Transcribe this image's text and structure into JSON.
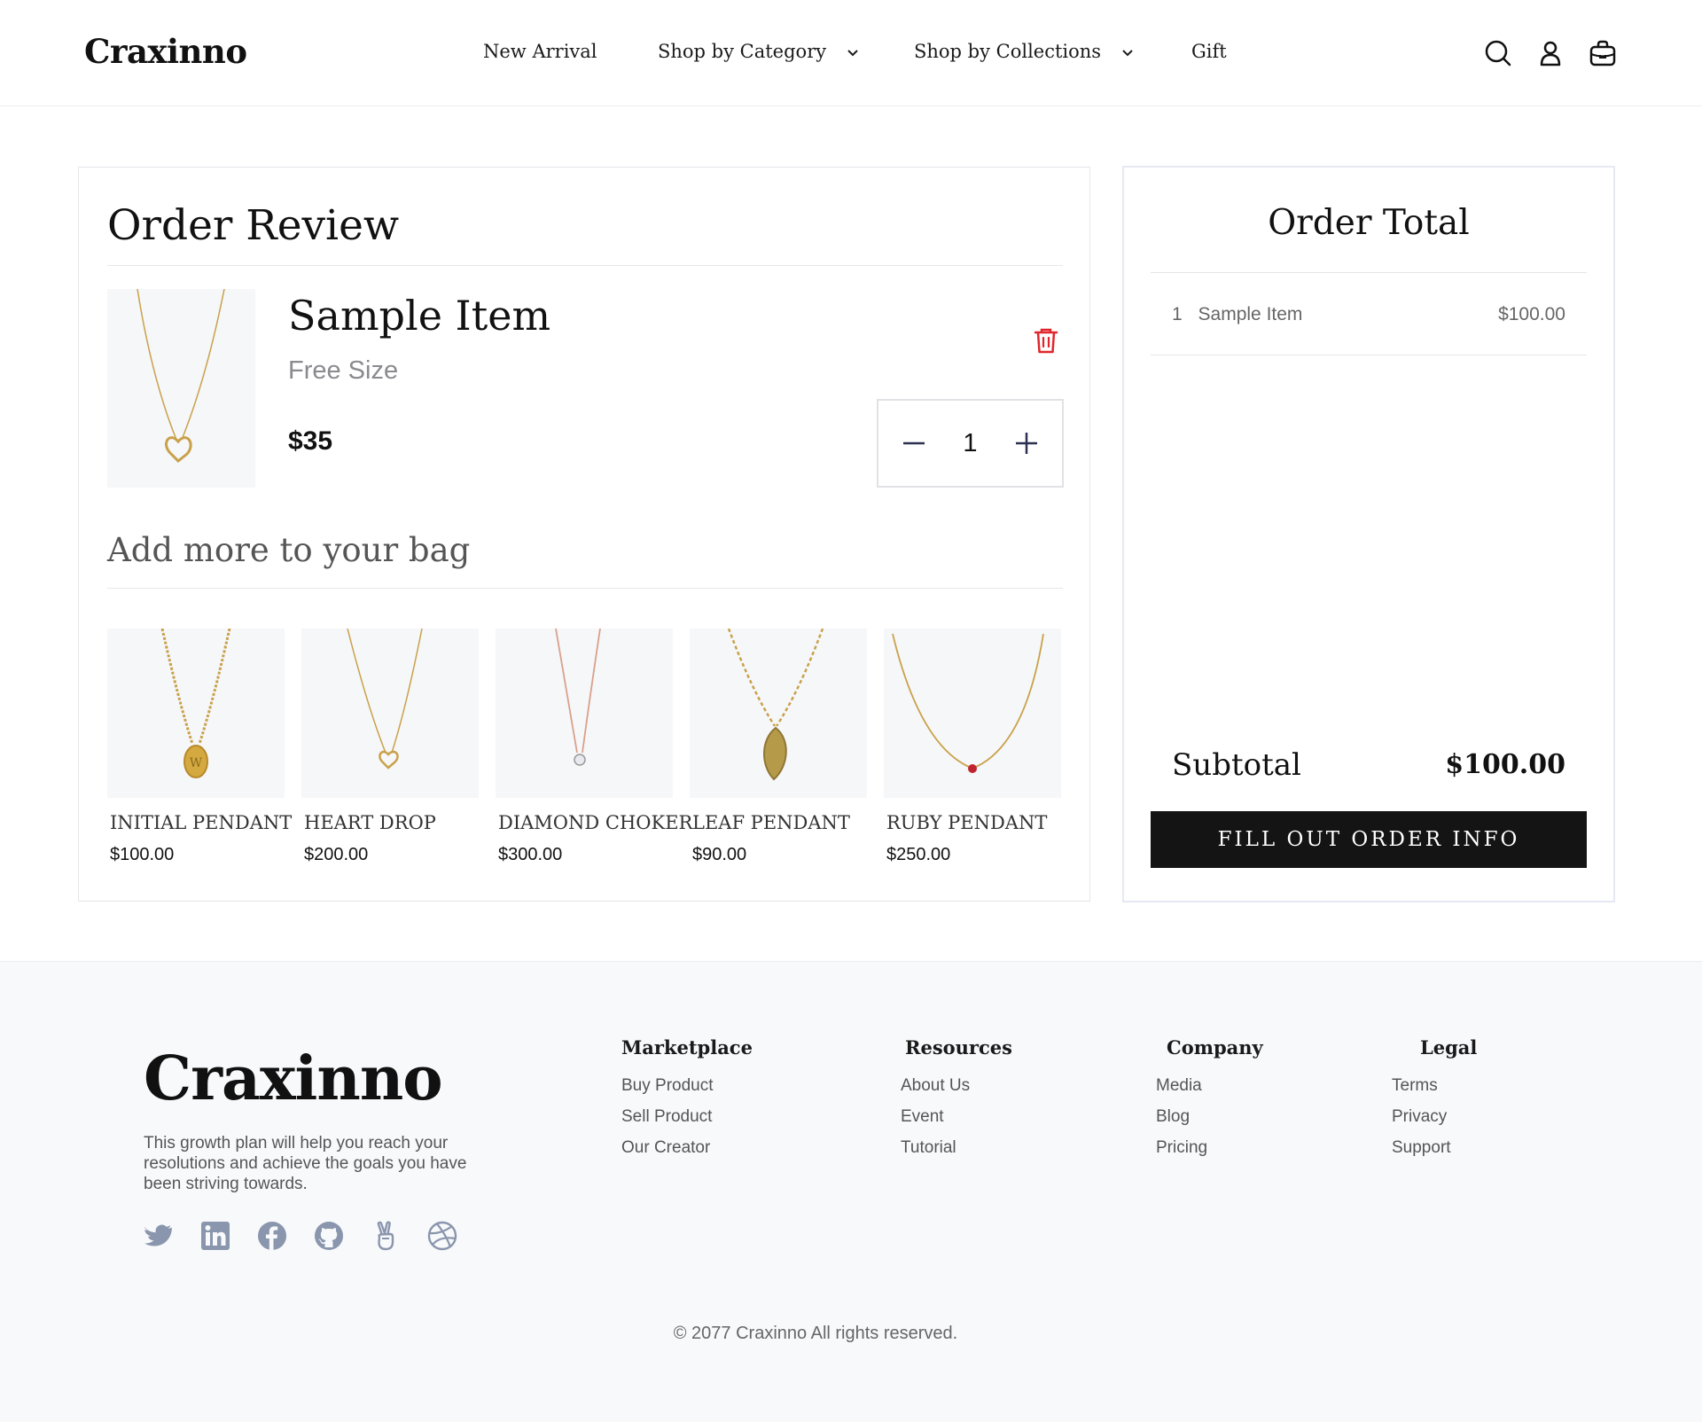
{
  "header": {
    "logo": "Craxinno",
    "nav": [
      {
        "label": "New Arrival"
      },
      {
        "label": "Shop by Category"
      },
      {
        "label": "Shop by Collections"
      },
      {
        "label": "Gift"
      }
    ],
    "icons": [
      "search-icon",
      "user-icon",
      "bag-icon"
    ]
  },
  "review": {
    "title": "Order Review",
    "item": {
      "name": "Sample Item",
      "size": "Free Size",
      "price": "$35",
      "quantity": "1"
    },
    "add_more_title": "Add more to your bag",
    "products": [
      {
        "name": "INITIAL PENDANT",
        "price": "$100.00"
      },
      {
        "name": "HEART DROP",
        "price": "$200.00"
      },
      {
        "name": "DIAMOND CHOKER",
        "price": "$300.00"
      },
      {
        "name": "LEAF PENDANT",
        "price": "$90.00"
      },
      {
        "name": "RUBY PENDANT",
        "price": "$250.00"
      }
    ]
  },
  "order_total": {
    "title": "Order Total",
    "line_items": [
      {
        "qty": "1",
        "name": "Sample Item",
        "amount": "$100.00"
      }
    ],
    "subtotal_label": "Subtotal",
    "subtotal_value": "$100.00",
    "cta_label": "FILL OUT ORDER INFO"
  },
  "footer": {
    "logo": "Craxinno",
    "description": "This growth plan will help you reach your resolutions and achieve the goals you have been striving towards.",
    "social_icons": [
      "twitter-icon",
      "linkedin-icon",
      "facebook-icon",
      "github-icon",
      "peace-icon",
      "dribbble-icon"
    ],
    "columns": [
      {
        "title": "Marketplace",
        "links": [
          "Buy Product",
          "Sell Product",
          "Our Creator"
        ]
      },
      {
        "title": "Resources",
        "links": [
          "About Us",
          "Event",
          "Tutorial"
        ]
      },
      {
        "title": "Company",
        "links": [
          "Media",
          "Blog",
          "Pricing"
        ]
      },
      {
        "title": "Legal",
        "links": [
          "Terms",
          "Privacy",
          "Support"
        ]
      }
    ],
    "copyright": "© 2077 Craxinno  All rights reserved."
  },
  "colors": {
    "accent_dark": "#141414",
    "danger": "#e0262d",
    "stepper_icon": "#2b3050",
    "social_icon": "#8a96ad",
    "gold": "#c9a14a"
  }
}
